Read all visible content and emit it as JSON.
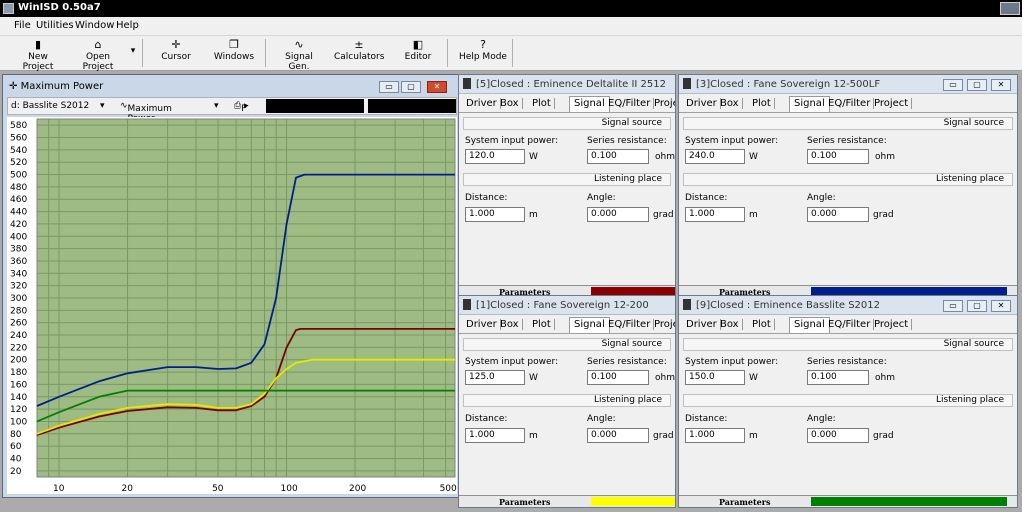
{
  "app": {
    "title": "WinISD 0.50a7"
  },
  "menu": [
    "File",
    "Utilities",
    "Window",
    "Help"
  ],
  "toolbar": {
    "new_project": "New Project",
    "open_project": "Open Project",
    "cursor": "Cursor",
    "windows": "Windows",
    "signal_gen": "Signal Gen.",
    "calculators": "Calculators",
    "editor": "Editor",
    "help_mode": "Help Mode"
  },
  "max_power_window": {
    "title": "Maximum Power",
    "driver_select": "d: Basslite S2012",
    "plot_select": "Maximum Power",
    "print_label": "P"
  },
  "chart_data": {
    "type": "line",
    "title": "",
    "xlabel": "",
    "ylabel": "",
    "x_scale": "log",
    "xlim": [
      8,
      550
    ],
    "ylim": [
      10,
      590
    ],
    "x_tick_labels": [
      10,
      20,
      50,
      100,
      200,
      500
    ],
    "y_tick_labels": [
      20,
      40,
      60,
      80,
      100,
      120,
      140,
      160,
      180,
      200,
      220,
      240,
      260,
      280,
      300,
      320,
      340,
      360,
      380,
      400,
      420,
      440,
      460,
      480,
      500,
      520,
      540,
      560,
      580
    ],
    "grid": true,
    "background": "#9dbb82",
    "series": [
      {
        "color": "#001f8c",
        "x": [
          8,
          10,
          15,
          20,
          30,
          40,
          50,
          60,
          70,
          80,
          90,
          100,
          110,
          120,
          550
        ],
        "y": [
          125,
          140,
          165,
          178,
          188,
          188,
          185,
          186,
          195,
          225,
          300,
          420,
          495,
          500,
          500
        ]
      },
      {
        "color": "#7a0000",
        "x": [
          8,
          10,
          15,
          20,
          30,
          40,
          50,
          60,
          70,
          80,
          90,
          100,
          110,
          115,
          550
        ],
        "y": [
          78,
          90,
          108,
          117,
          123,
          122,
          118,
          118,
          125,
          140,
          170,
          220,
          248,
          250,
          250
        ]
      },
      {
        "color": "#e8e800",
        "x": [
          8,
          10,
          15,
          20,
          30,
          40,
          50,
          60,
          70,
          80,
          90,
          100,
          110,
          130,
          550
        ],
        "y": [
          80,
          93,
          112,
          122,
          128,
          127,
          122,
          122,
          128,
          145,
          170,
          185,
          195,
          200,
          200
        ]
      },
      {
        "color": "#008000",
        "x": [
          8,
          10,
          15,
          20,
          550
        ],
        "y": [
          100,
          115,
          140,
          150,
          150
        ]
      }
    ]
  },
  "panels": [
    {
      "title": "[5]Closed : Eminence Deltalite II 2512",
      "input_power": "120.0",
      "series_resistance": "0.100",
      "distance": "1.000",
      "angle": "0.000",
      "color": "#8b0000"
    },
    {
      "title": "[3]Closed : Fane Sovereign 12-500LF",
      "input_power": "240.0",
      "series_resistance": "0.100",
      "distance": "1.000",
      "angle": "0.000",
      "color": "#001f8c"
    },
    {
      "title": "[1]Closed : Fane Sovereign 12-200",
      "input_power": "125.0",
      "series_resistance": "0.100",
      "distance": "1.000",
      "angle": "0.000",
      "color": "#ffff00"
    },
    {
      "title": "[9]Closed : Eminence Basslite S2012",
      "input_power": "150.0",
      "series_resistance": "0.100",
      "distance": "1.000",
      "angle": "0.000",
      "color": "#008000"
    }
  ],
  "panel_labels": {
    "tabs": [
      "Driver",
      "Box",
      "Plot",
      "Signal",
      "EQ/Filter",
      "Project"
    ],
    "narrow_project_tab": "Projec",
    "signal_source": "Signal source",
    "system_input_power": "System input power:",
    "series_resistance": "Series resistance:",
    "unit_w": "W",
    "unit_ohm": "ohm",
    "listening_place": "Listening place",
    "distance": "Distance:",
    "angle": "Angle:",
    "unit_m": "m",
    "unit_grad": "grad",
    "parameters": "Parameters"
  }
}
